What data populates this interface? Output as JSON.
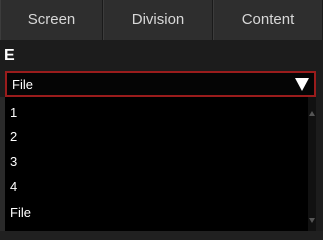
{
  "tabs": [
    "Screen",
    "Division",
    "Content"
  ],
  "section": {
    "letter": "E"
  },
  "select": {
    "value": "File"
  },
  "dropdown": {
    "options": [
      "1",
      "2",
      "3",
      "4",
      "File"
    ]
  }
}
